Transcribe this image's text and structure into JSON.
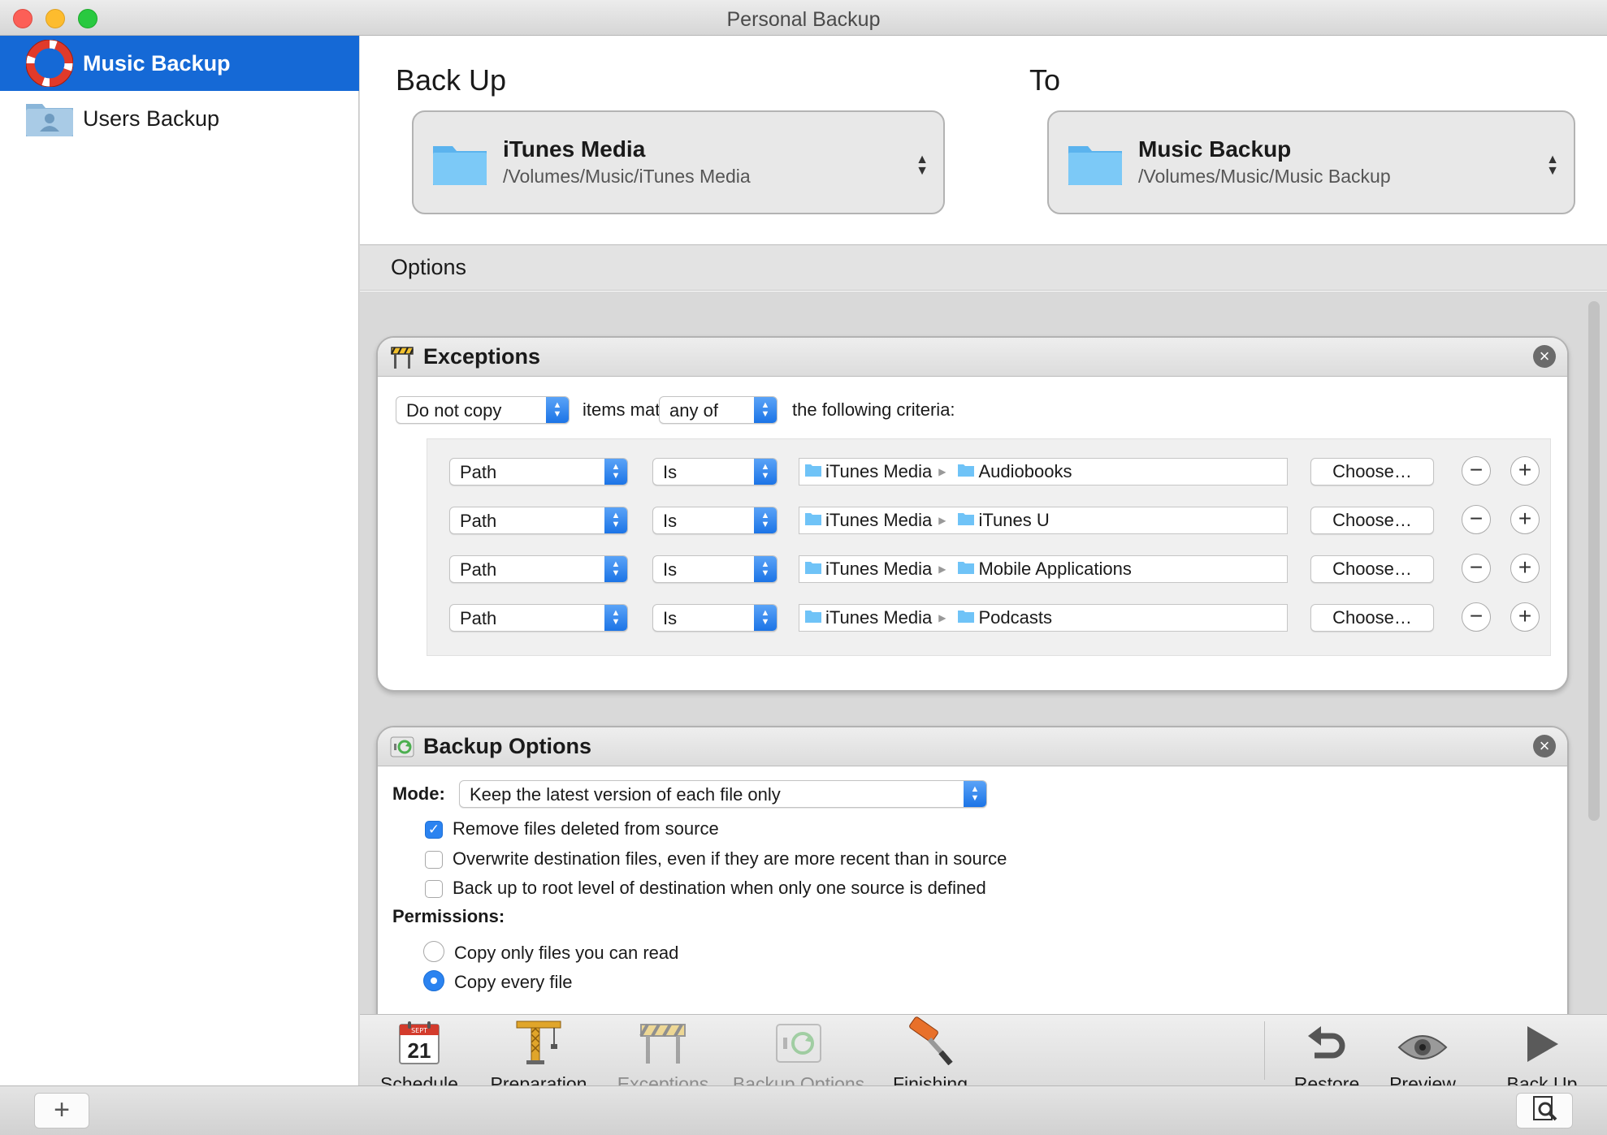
{
  "window": {
    "title": "Personal Backup"
  },
  "sidebar": {
    "items": [
      {
        "label": "Music Backup",
        "selected": true,
        "icon": "lifebuoy-icon"
      },
      {
        "label": "Users Backup",
        "selected": false,
        "icon": "users-folder-icon"
      }
    ]
  },
  "header": {
    "backup_label": "Back Up",
    "to_label": "To",
    "source": {
      "name": "iTunes Media",
      "path": "/Volumes/Music/iTunes Media"
    },
    "destination": {
      "name": "Music Backup",
      "path": "/Volumes/Music/Music Backup"
    }
  },
  "options": {
    "label": "Options",
    "exceptions": {
      "title": "Exceptions",
      "action": "Do not copy",
      "items_matching": "items matching",
      "match": "any of",
      "following": "the following criteria:",
      "rows": [
        {
          "field": "Path",
          "op": "Is",
          "root": "iTunes Media",
          "target": "Audiobooks",
          "choose": "Choose…"
        },
        {
          "field": "Path",
          "op": "Is",
          "root": "iTunes Media",
          "target": "iTunes U",
          "choose": "Choose…"
        },
        {
          "field": "Path",
          "op": "Is",
          "root": "iTunes Media",
          "target": "Mobile Applications",
          "choose": "Choose…"
        },
        {
          "field": "Path",
          "op": "Is",
          "root": "iTunes Media",
          "target": "Podcasts",
          "choose": "Choose…"
        }
      ]
    },
    "backup_options": {
      "title": "Backup Options",
      "mode_label": "Mode:",
      "mode_value": "Keep the latest version of each file only",
      "checks": [
        {
          "label": "Remove files deleted from source",
          "checked": true
        },
        {
          "label": "Overwrite destination files, even if they are more recent than in source",
          "checked": false
        },
        {
          "label": "Back up to root level of destination when only one source is defined",
          "checked": false
        }
      ],
      "permissions_label": "Permissions:",
      "permissions": [
        {
          "label": "Copy only files you can read",
          "selected": false
        },
        {
          "label": "Copy every file",
          "selected": true
        }
      ]
    }
  },
  "toolbar": {
    "schedule": "Schedule",
    "calendar_month": "SEPT",
    "calendar_day": "21",
    "preparation": "Preparation",
    "exceptions": "Exceptions",
    "backup_options": "Backup Options",
    "finishing": "Finishing",
    "restore": "Restore",
    "preview": "Preview",
    "back_up": "Back Up"
  },
  "bottom": {
    "add": "+"
  },
  "colors": {
    "accent": "#1569d6",
    "checkbox_on": "#2b83f0",
    "folder": "#6fc3f7"
  }
}
